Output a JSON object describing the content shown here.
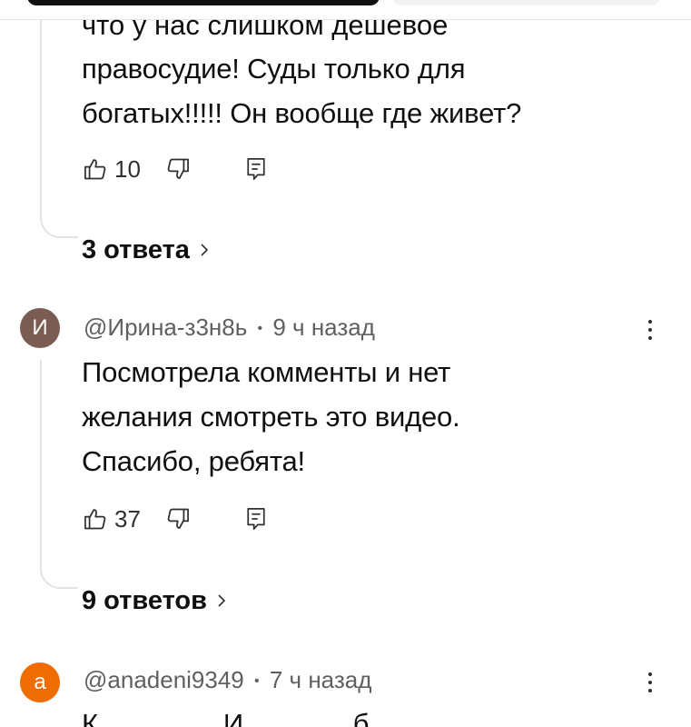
{
  "comment_prev": {
    "partial_top_line": "что у нас слишком дешевое",
    "text_lines": [
      "правосудие! Суды только для",
      "богатых!!!!!  Он вообще где живет?"
    ],
    "likes": "10",
    "replies_label": "3 ответа"
  },
  "comment_irina": {
    "avatar_letter": "И",
    "avatar_color": "#7a5c52",
    "handle": "@Ирина-з3н8ь",
    "separator": "•",
    "time": "9 ч назад",
    "text_lines": [
      "Посмотрела комменты и нет",
      "желания смотреть это видео.",
      "Спасибо, ребята!"
    ],
    "likes": "37",
    "replies_label": "9 ответов"
  },
  "comment_anadeni": {
    "avatar_letter": "а",
    "avatar_color": "#ef6c00",
    "handle": "@anadeni9349",
    "separator": "•",
    "time": "7 ч назад",
    "partial_text": "К                И              б"
  },
  "icons": {
    "like": "thumb-up-icon",
    "dislike": "thumb-down-icon",
    "reply": "reply-icon",
    "expand": "chevron-right-icon",
    "menu": "more-vert-icon"
  }
}
